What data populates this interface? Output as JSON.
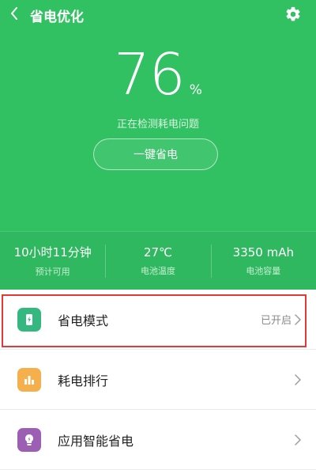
{
  "header": {
    "title": "省电优化",
    "battery_percent": "76",
    "percent_unit": "%",
    "status_text": "正在检测耗电问题",
    "save_button": "一键省电",
    "colors": {
      "background": "#31c062",
      "highlight": "#e53935"
    }
  },
  "stats": [
    {
      "value": "10小时11分钟",
      "label": "预计可用"
    },
    {
      "value": "27℃",
      "label": "电池温度"
    },
    {
      "value": "3350 mAh",
      "label": "电池容量"
    }
  ],
  "list": [
    {
      "label": "省电模式",
      "value": "已开启",
      "icon": "battery-icon",
      "color": "#34b87f"
    },
    {
      "label": "耗电排行",
      "value": "",
      "icon": "bar-chart-icon",
      "color": "#f5b04d"
    },
    {
      "label": "应用智能省电",
      "value": "",
      "icon": "bulb-icon",
      "color": "#9d5fb3"
    }
  ]
}
